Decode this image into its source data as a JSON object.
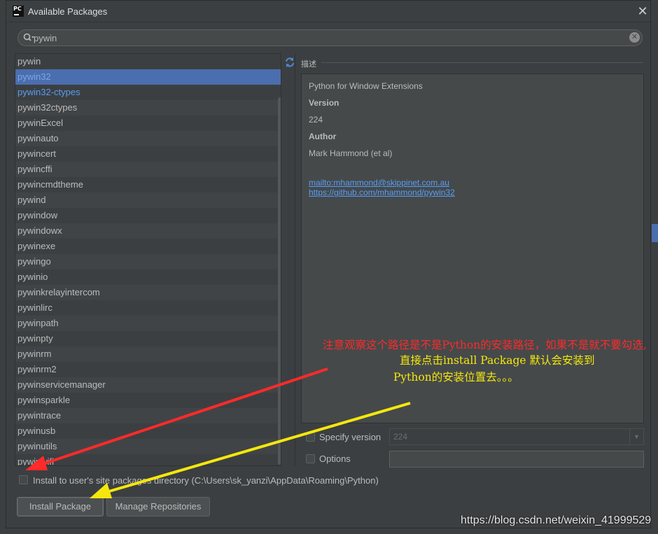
{
  "window": {
    "title": "Available Packages",
    "logo_text": "PC",
    "close_glyph": "✕"
  },
  "search": {
    "value": "pywin",
    "clear_glyph": "✕"
  },
  "packages": [
    {
      "name": "pywin",
      "state": "normal"
    },
    {
      "name": "pywin32",
      "state": "selected"
    },
    {
      "name": "pywin32-ctypes",
      "state": "link"
    },
    {
      "name": "pywin32ctypes",
      "state": "normal"
    },
    {
      "name": "pywinExcel",
      "state": "normal"
    },
    {
      "name": "pywinauto",
      "state": "normal"
    },
    {
      "name": "pywincert",
      "state": "normal"
    },
    {
      "name": "pywincffi",
      "state": "normal"
    },
    {
      "name": "pywincmdtheme",
      "state": "normal"
    },
    {
      "name": "pywind",
      "state": "normal"
    },
    {
      "name": "pywindow",
      "state": "normal"
    },
    {
      "name": "pywindowx",
      "state": "normal"
    },
    {
      "name": "pywinexe",
      "state": "normal"
    },
    {
      "name": "pywingo",
      "state": "normal"
    },
    {
      "name": "pywinio",
      "state": "normal"
    },
    {
      "name": "pywinkrelayintercom",
      "state": "normal"
    },
    {
      "name": "pywinlirc",
      "state": "normal"
    },
    {
      "name": "pywinpath",
      "state": "normal"
    },
    {
      "name": "pywinpty",
      "state": "normal"
    },
    {
      "name": "pywinrm",
      "state": "normal"
    },
    {
      "name": "pywinrm2",
      "state": "normal"
    },
    {
      "name": "pywinservicemanager",
      "state": "normal"
    },
    {
      "name": "pywinsparkle",
      "state": "normal"
    },
    {
      "name": "pywintrace",
      "state": "normal"
    },
    {
      "name": "pywinusb",
      "state": "normal"
    },
    {
      "name": "pywinutils",
      "state": "normal"
    },
    {
      "name": "pywinwifi",
      "state": "normal"
    }
  ],
  "description": {
    "header": "描述",
    "summary": "Python for Window Extensions",
    "version_label": "Version",
    "version_value": "224",
    "author_label": "Author",
    "author_value": "Mark Hammond (et al)",
    "mail_link": "mailto:mhammond@skippinet.com.au",
    "repo_link": "https://github.com/mhammond/pywin32"
  },
  "options": {
    "specify_version_label": "Specify version",
    "specify_version_value": "224",
    "specify_version_checked": false,
    "options_label": "Options",
    "options_value": "",
    "options_checked": false,
    "site_packages_label": "Install to user's site packages directory (C:\\Users\\sk_yanzi\\AppData\\Roaming\\Python)",
    "site_packages_checked": false
  },
  "buttons": {
    "install": "Install Package",
    "manage": "Manage Repositories"
  },
  "annotation": {
    "red_text": "注意观察这个路径是不是Python的安装路径，如果不是就不要勾选,",
    "yellow_text_1": "直接点击install Package  默认会安装到",
    "yellow_text_2": "Python的安装位置去。。。",
    "red_color": "#ff2a2a",
    "yellow_color": "#f5e70c"
  },
  "watermark": "https://blog.csdn.net/weixin_41999529",
  "colors": {
    "dialog_bg": "#3c3f41",
    "selection": "#4b6eaf",
    "link": "#589df6"
  }
}
